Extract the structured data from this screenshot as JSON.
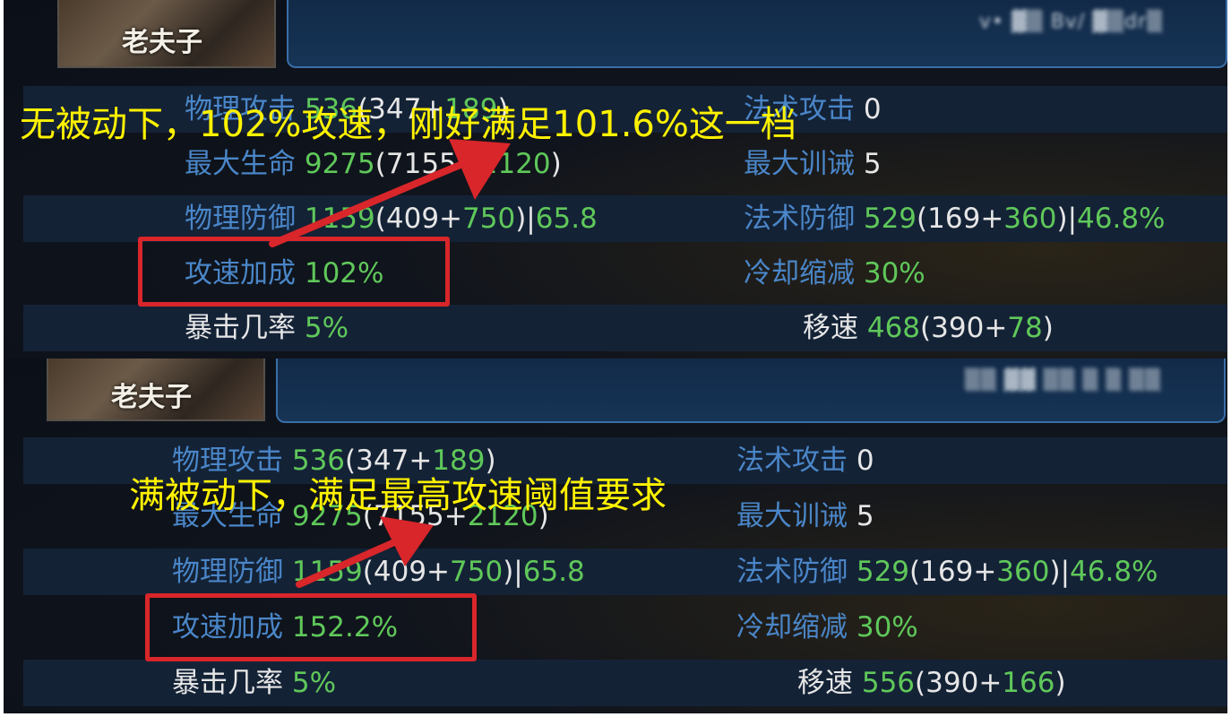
{
  "colors": {
    "label_blue": "#4a86c8",
    "value_green": "#5fc85a",
    "annotation_yellow": "#fff200",
    "highlight_red": "#d8262a"
  },
  "panels": [
    {
      "hero_name": "老夫子",
      "player_id": "v• ▓▒ Bv/ ▓▒dr▒",
      "annotation": "无被动下，102%攻速，刚好满足101.6%这一档",
      "stats": {
        "phys_attack": {
          "label": "物理攻击",
          "total": "536",
          "base": "347",
          "bonus": "189"
        },
        "magic_attack": {
          "label": "法术攻击",
          "value": "0"
        },
        "max_hp": {
          "label": "最大生命",
          "total": "9275",
          "base": "7155",
          "bonus": "2120"
        },
        "max_training": {
          "label": "最大训诫",
          "value": "5"
        },
        "phys_def": {
          "label": "物理防御",
          "total": "1159",
          "base": "409",
          "bonus": "750",
          "pct": "65.8"
        },
        "magic_def": {
          "label": "法术防御",
          "total": "529",
          "base": "169",
          "bonus": "360",
          "pct": "46.8%"
        },
        "attack_speed": {
          "label": "攻速加成",
          "value": "102%"
        },
        "cooldown": {
          "label": "冷却缩减",
          "value": "30%"
        },
        "crit": {
          "label": "暴击几率",
          "value": "5%"
        },
        "move_speed": {
          "label": "移速",
          "total": "468",
          "base": "390",
          "bonus": "78"
        }
      }
    },
    {
      "hero_name": "老夫子",
      "player_id": "▒▒ ▓▓ ▒▒ ▒ ▒ ▒▒",
      "annotation": "满被动下，满足最高攻速阈值要求",
      "stats": {
        "phys_attack": {
          "label": "物理攻击",
          "total": "536",
          "base": "347",
          "bonus": "189"
        },
        "magic_attack": {
          "label": "法术攻击",
          "value": "0"
        },
        "max_hp": {
          "label": "最大生命",
          "total": "9275",
          "base": "7155",
          "bonus": "2120"
        },
        "max_training": {
          "label": "最大训诫",
          "value": "5"
        },
        "phys_def": {
          "label": "物理防御",
          "total": "1159",
          "base": "409",
          "bonus": "750",
          "pct": "65.8"
        },
        "magic_def": {
          "label": "法术防御",
          "total": "529",
          "base": "169",
          "bonus": "360",
          "pct": "46.8%"
        },
        "attack_speed": {
          "label": "攻速加成",
          "value": "152.2%"
        },
        "cooldown": {
          "label": "冷却缩减",
          "value": "30%"
        },
        "crit": {
          "label": "暴击几率",
          "value": "5%"
        },
        "move_speed": {
          "label": "移速",
          "total": "556",
          "base": "390",
          "bonus": "166"
        }
      }
    }
  ]
}
